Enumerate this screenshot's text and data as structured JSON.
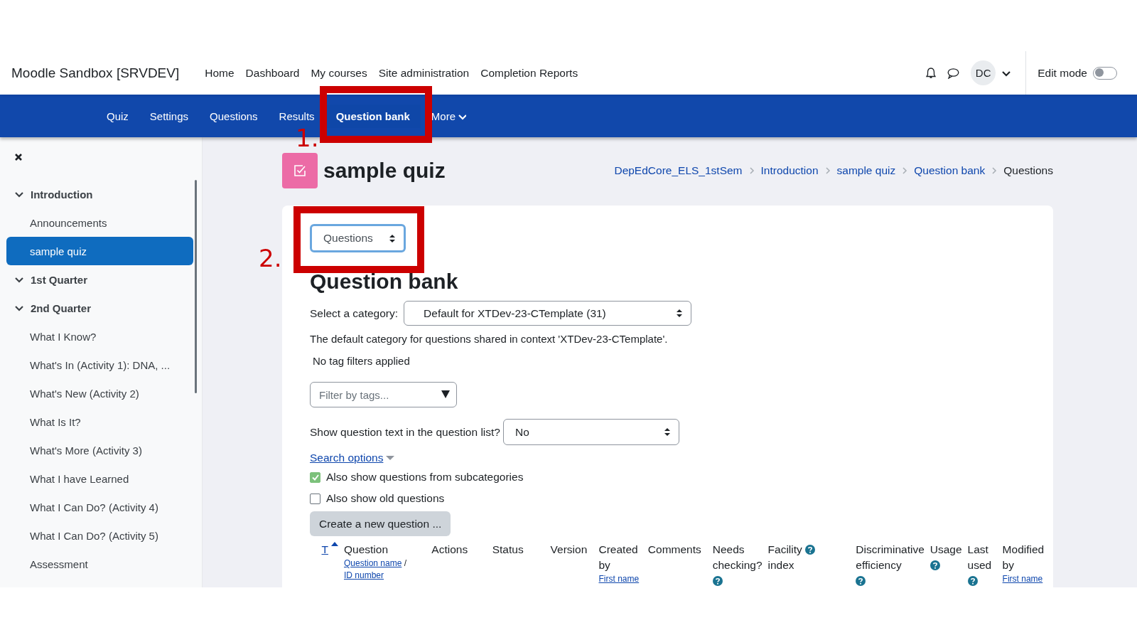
{
  "site_name": "Moodle Sandbox [SRVDEV]",
  "primary_nav": [
    "Home",
    "Dashboard",
    "My courses",
    "Site administration",
    "Completion Reports"
  ],
  "user": {
    "initials": "DC"
  },
  "edit_mode": {
    "label": "Edit mode",
    "on": false
  },
  "secondary_nav": [
    {
      "label": "Quiz",
      "selected": false
    },
    {
      "label": "Settings",
      "selected": false
    },
    {
      "label": "Questions",
      "selected": false
    },
    {
      "label": "Results",
      "selected": false
    },
    {
      "label": "Question bank",
      "selected": true
    },
    {
      "label": "More",
      "selected": false,
      "kind": "dropdown"
    }
  ],
  "annotations": [
    {
      "label": "1."
    },
    {
      "label": "2."
    }
  ],
  "sidebar": {
    "items": [
      {
        "label": "Introduction",
        "expanded": true,
        "children": [
          {
            "label": "Announcements",
            "selected": false
          },
          {
            "label": "sample quiz",
            "selected": true
          }
        ]
      },
      {
        "label": "1st Quarter",
        "expanded": true
      },
      {
        "label": "2nd Quarter",
        "expanded": true,
        "children": [
          {
            "label": "What I Know?",
            "selected": false
          },
          {
            "label": "What's In (Activity 1): DNA, ...",
            "selected": false
          },
          {
            "label": "What's New (Activity 2)",
            "selected": false
          },
          {
            "label": "What Is It?",
            "selected": false
          },
          {
            "label": "What's More (Activity 3)",
            "selected": false
          },
          {
            "label": "What I have Learned",
            "selected": false
          },
          {
            "label": "What I Can Do? (Activity 4)",
            "selected": false
          },
          {
            "label": "What I Can Do? (Activity 5)",
            "selected": false
          },
          {
            "label": "Assessment",
            "selected": false
          }
        ]
      }
    ]
  },
  "page": {
    "title": "sample quiz",
    "breadcrumb": [
      "DepEdCore_ELS_1stSem",
      "Introduction",
      "sample quiz",
      "Question bank",
      "Questions"
    ]
  },
  "question_bank": {
    "nav_select": "Questions",
    "heading": "Question bank",
    "category_label": "Select a category:",
    "category_value": "Default for XTDev-23-CTemplate (31)",
    "category_note": "The default category for questions shared in context 'XTDev-23-CTemplate'.",
    "tag_status": "No tag filters applied",
    "tag_filter": {
      "placeholder": "Filter by tags..."
    },
    "show_text_label": "Show question text in the question list?",
    "show_text_value": "No",
    "search_options": "Search options",
    "options": [
      {
        "label": "Also show questions from subcategories",
        "checked": true
      },
      {
        "label": "Also show old questions",
        "checked": false
      }
    ],
    "create_button": "Create a new question ...",
    "table": {
      "columns": [
        {
          "label": "T",
          "kind": "sort",
          "sorted": true
        },
        {
          "label": "Question",
          "links": [
            {
              "kind": "link",
              "text": "Question name"
            },
            {
              "kind": "sep",
              "text": "/"
            },
            {
              "kind": "link",
              "text": "ID number"
            }
          ]
        },
        {
          "label": "Actions"
        },
        {
          "label": "Status"
        },
        {
          "label": "Version"
        },
        {
          "label": "Created by",
          "links": [
            {
              "kind": "link",
              "text": "First name"
            }
          ]
        },
        {
          "label": "Comments"
        },
        {
          "label": "Needs checking?",
          "help": true
        },
        {
          "label": "Facility index",
          "help": true
        },
        {
          "label": "Discriminative efficiency",
          "help": true
        },
        {
          "label": "Usage",
          "help": true
        },
        {
          "label": "Last used",
          "help": true
        },
        {
          "label": "Modified by",
          "links": [
            {
              "kind": "link",
              "text": "First name"
            }
          ]
        }
      ]
    }
  }
}
